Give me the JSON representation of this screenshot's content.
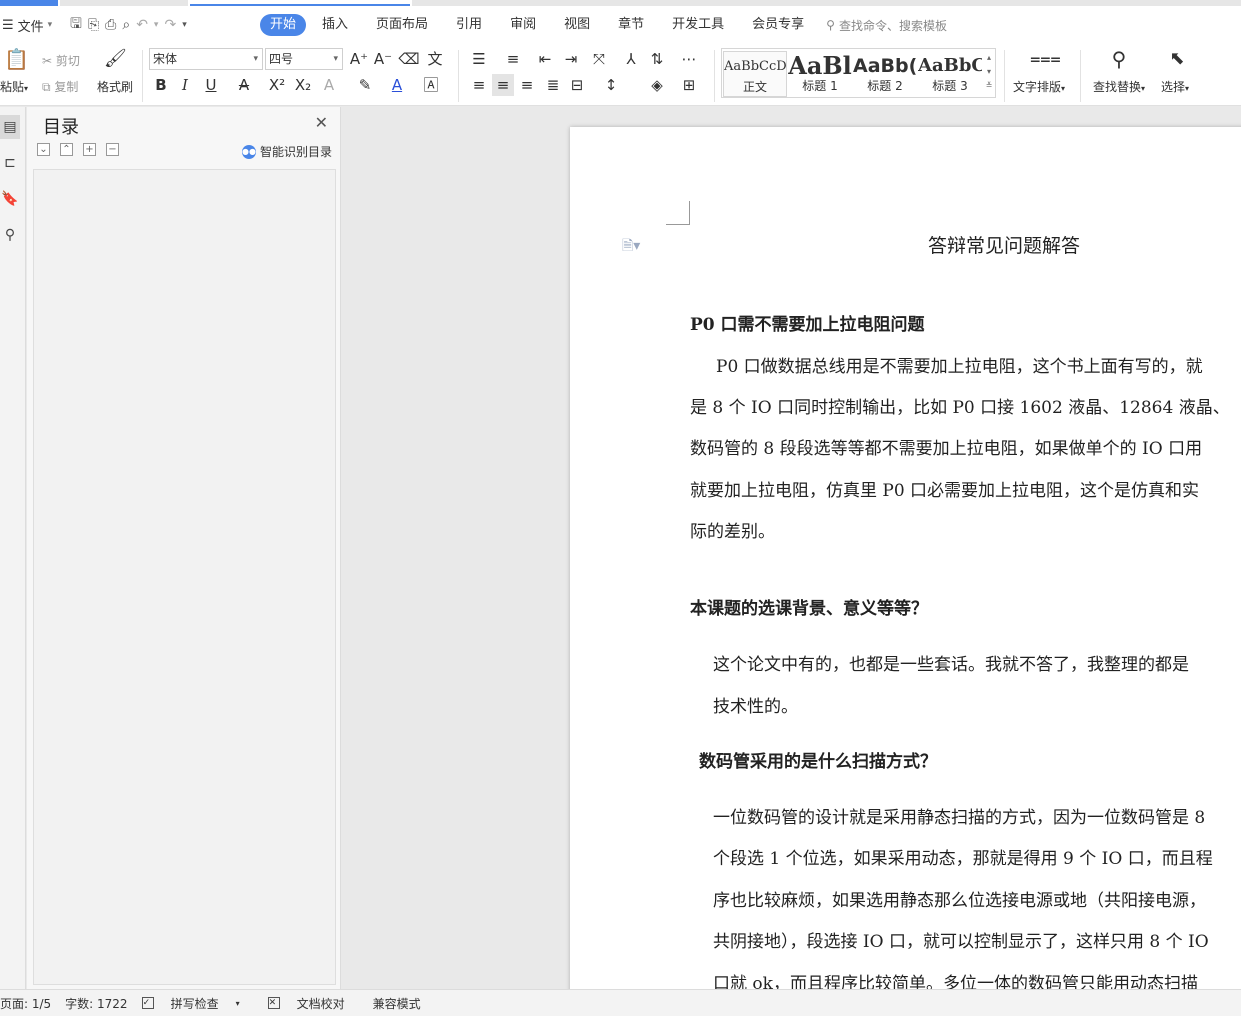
{
  "menu": {
    "file_label": "文件",
    "tabs": [
      {
        "label": "开始"
      },
      {
        "label": "插入"
      },
      {
        "label": "页面布局"
      },
      {
        "label": "引用"
      },
      {
        "label": "审阅"
      },
      {
        "label": "视图"
      },
      {
        "label": "章节"
      },
      {
        "label": "开发工具"
      },
      {
        "label": "会员专享"
      }
    ],
    "search_placeholder": "查找命令、搜索模板"
  },
  "ribbon": {
    "paste": "粘贴",
    "cut": "剪切",
    "copy": "复制",
    "format_painter": "格式刷",
    "font_name": "宋体",
    "font_size": "四号",
    "styles": [
      {
        "preview": "AaBbCcDd",
        "label": "正文"
      },
      {
        "preview": "AaBl",
        "label": "标题 1"
      },
      {
        "preview": "AaBb(",
        "label": "标题 2"
      },
      {
        "preview": "AaBbC",
        "label": "标题 3"
      }
    ],
    "text_layout": "文字排版",
    "find_replace": "查找替换",
    "select": "选择"
  },
  "toc": {
    "title": "目录",
    "smart_label": "智能识别目录"
  },
  "document": {
    "title": "答辩常见问题解答",
    "sections": [
      {
        "heading": "P0 口需不需要加上拉电阻问题",
        "lines": [
          "P0 口做数据总线用是不需要加上拉电阻，这个书上面有写的，就",
          "是 8 个 IO 口同时控制输出，比如 P0 口接 1602 液晶、12864 液晶、",
          "数码管的 8 段段选等等都不需要加上拉电阻，如果做单个的 IO 口用",
          "就要加上拉电阻，仿真里 P0 口必需要加上拉电阻，这个是仿真和实",
          "际的差别。"
        ]
      },
      {
        "heading": "本课题的选课背景、意义等等？",
        "lines": [
          "这个论文中有的，也都是一些套话。我就不答了，我整理的都是",
          "技术性的。"
        ]
      },
      {
        "heading": "数码管采用的是什么扫描方式？",
        "lines": [
          "一位数码管的设计就是采用静态扫描的方式，因为一位数码管是 8",
          "个段选 1 个位选，如果采用动态，那就是得用 9 个 IO 口，而且程",
          "序也比较麻烦，如果选用静态那么位选接电源或地（共阳接电源，",
          "共阴接地），段选接 IO 口，就可以控制显示了，这样只用 8 个 IO",
          "口就 ok，而且程序比较简单。多位一体的数码管只能用动态扫描"
        ]
      }
    ]
  },
  "status": {
    "page": "页面: 1/5",
    "words": "字数: 1722",
    "spellcheck": "拼写检查",
    "proof": "文档校对",
    "compat": "兼容模式"
  },
  "colors": {
    "accent": "#4a86e8"
  }
}
